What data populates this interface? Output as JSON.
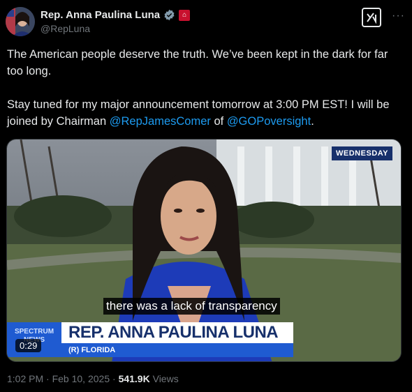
{
  "author": {
    "name": "Rep. Anna Paulina Luna",
    "handle": "@RepLuna"
  },
  "post": {
    "line1": "The American people deserve the truth. We’ve been kept in the dark for far too long.",
    "line2_prefix": "Stay tuned for my major announcement tomorrow at 3:00 PM EST! I will be joined by Chairman ",
    "mention1": "@RepJamesComer",
    "line2_mid": " of ",
    "mention2": "@GOPoversight",
    "line2_suffix": "."
  },
  "video": {
    "day_tag": "WEDNESDAY",
    "caption": "there was a lack of transparency",
    "brand_line1": "SPECTRUM",
    "brand_line2": "NEWS",
    "lower_third_name": "REP. ANNA PAULINA LUNA",
    "lower_third_sub": "(R) FLORIDA",
    "timer": "0:29"
  },
  "meta": {
    "time": "1:02 PM",
    "separator": "·",
    "date": "Feb 10, 2025",
    "views_count": "541.9K",
    "views_label": "Views"
  },
  "colors": {
    "background": "#000000",
    "mention": "#1d9bf0",
    "secondary_text": "#71767b",
    "brand_blue": "#1f5bd1"
  }
}
